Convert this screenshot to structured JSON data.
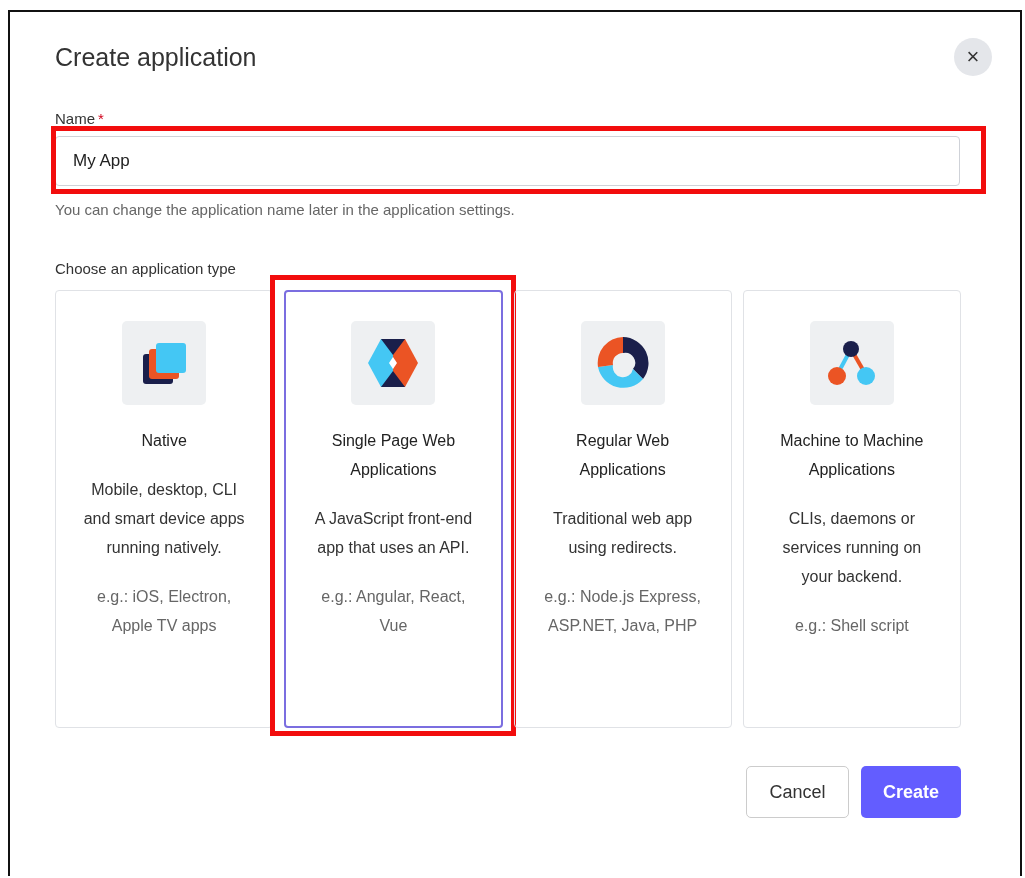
{
  "dialog": {
    "title": "Create application",
    "close": "×"
  },
  "name_field": {
    "label": "Name",
    "required_mark": "*",
    "value": "My App",
    "highlighted": true,
    "hint": "You can change the application name later in the application settings."
  },
  "type_section": {
    "label": "Choose an application type",
    "cards": [
      {
        "title": "Native",
        "description": "Mobile, desktop, CLI and smart device apps running natively.",
        "examples": "e.g.: iOS, Electron, Apple TV apps",
        "selected": false,
        "highlighted": false
      },
      {
        "title": "Single Page Web Applications",
        "description": "A JavaScript front-end app that uses an API.",
        "examples": "e.g.: Angular, React, Vue",
        "selected": true,
        "highlighted": true
      },
      {
        "title": "Regular Web Applications",
        "description": "Traditional web app using redirects.",
        "examples": "e.g.: Node.js Express, ASP.NET, Java, PHP",
        "selected": false,
        "highlighted": false
      },
      {
        "title": "Machine to Machine Applications",
        "description": "CLIs, daemons or services running on your backend.",
        "examples": "e.g.: Shell script",
        "selected": false,
        "highlighted": false
      }
    ]
  },
  "buttons": [
    {
      "label": "Cancel",
      "kind": "secondary"
    },
    {
      "label": "Create",
      "kind": "primary"
    }
  ]
}
